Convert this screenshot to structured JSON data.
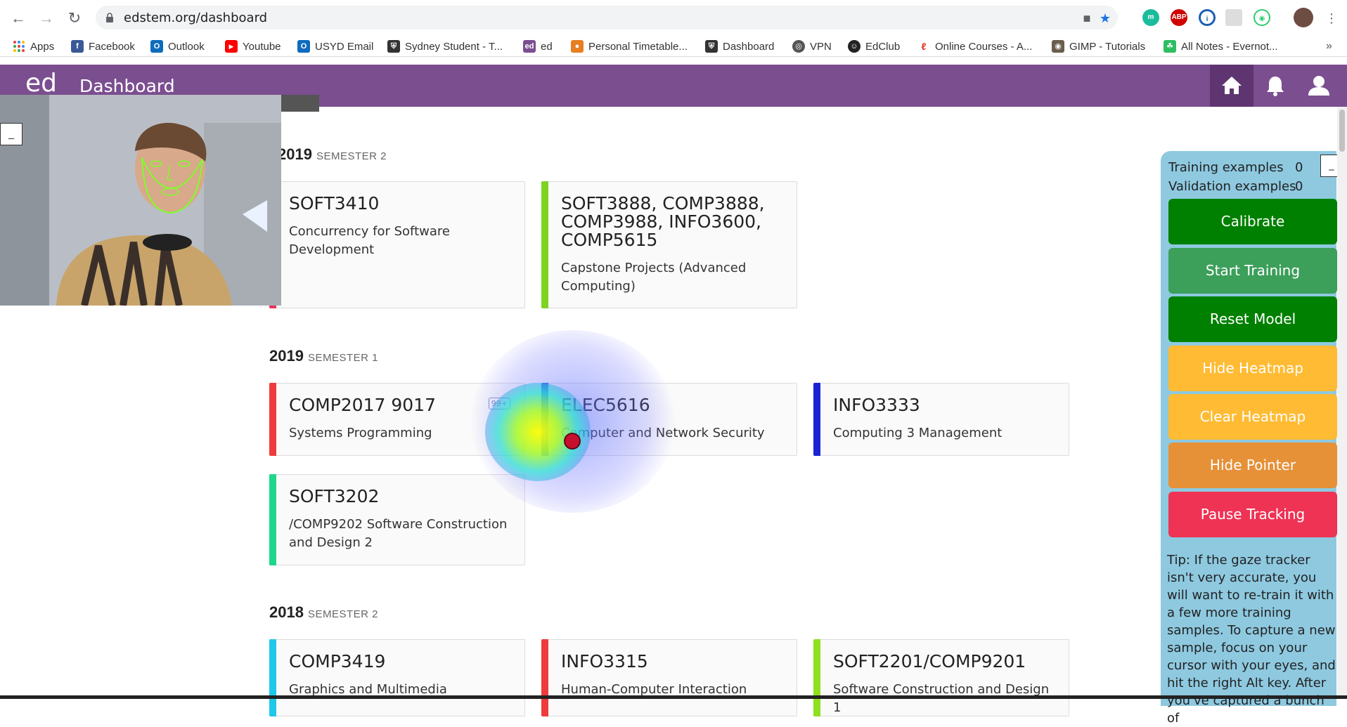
{
  "browser": {
    "url": "edstem.org/dashboard",
    "bookmarks": [
      {
        "label": "Apps",
        "icon": "apps-grid-icon",
        "color": "#e8453c"
      },
      {
        "label": "Facebook",
        "icon": "facebook-icon",
        "color": "#3b5998"
      },
      {
        "label": "Outlook",
        "icon": "outlook-icon",
        "color": "#0f6cbd"
      },
      {
        "label": "Youtube",
        "icon": "youtube-icon",
        "color": "#ff0000"
      },
      {
        "label": "USYD Email",
        "icon": "outlook-icon",
        "color": "#0f6cbd"
      },
      {
        "label": "Sydney Student - T...",
        "icon": "usyd-shield-icon",
        "color": "#333333"
      },
      {
        "label": "ed",
        "icon": "ed-icon",
        "color": "#7b4e90"
      },
      {
        "label": "Personal Timetable...",
        "icon": "timetable-icon",
        "color": "#e67e22"
      },
      {
        "label": "Dashboard",
        "icon": "usyd-shield-icon",
        "color": "#333333"
      },
      {
        "label": "VPN",
        "icon": "globe-icon",
        "color": "#555555"
      },
      {
        "label": "EdClub",
        "icon": "edclub-icon",
        "color": "#222222"
      },
      {
        "label": "Online Courses - A...",
        "icon": "adobe-icon",
        "color": "#e0301e"
      },
      {
        "label": "GIMP - Tutorials",
        "icon": "gimp-icon",
        "color": "#6b5e4f"
      },
      {
        "label": "All Notes - Evernot...",
        "icon": "evernote-icon",
        "color": "#2dbe60"
      }
    ]
  },
  "header": {
    "logo": "ed",
    "title": "Dashboard"
  },
  "semesters": [
    {
      "year": "2019",
      "sem": "SEMESTER 2",
      "courses": [
        {
          "code": "SOFT3410",
          "name": "Concurrency for Software Development",
          "color": "#e8325a"
        },
        {
          "code": "SOFT3888, COMP3888, COMP3988, INFO3600, COMP5615",
          "name": "Capstone Projects (Advanced Computing)",
          "color": "#7ed321"
        }
      ]
    },
    {
      "year": "2019",
      "sem": "SEMESTER 1",
      "courses": [
        {
          "code": "COMP2017 9017",
          "name": "Systems Programming",
          "color": "#ef3b3b",
          "badge": "99+"
        },
        {
          "code": "ELEC5616",
          "name": "Computer and Network Security",
          "color": "#2b5ce6"
        },
        {
          "code": "INFO3333",
          "name": "Computing 3 Management",
          "color": "#1a24d6"
        },
        {
          "code": "SOFT3202",
          "name": "/COMP9202 Software Construction and Design 2",
          "color": "#1fd68a"
        }
      ]
    },
    {
      "year": "2018",
      "sem": "SEMESTER 2",
      "courses": [
        {
          "code": "COMP3419",
          "name": "Graphics and Multimedia",
          "color": "#1ec8e8"
        },
        {
          "code": "INFO3315",
          "name": "Human-Computer Interaction",
          "color": "#ef3b3b"
        },
        {
          "code": "SOFT2201/COMP9201",
          "name": "Software Construction and Design 1",
          "color": "#8fe01e"
        }
      ]
    }
  ],
  "panel": {
    "training_label": "Training examples",
    "training_count": "0",
    "validation_label": "Validation examples",
    "validation_count": "0",
    "minimize": "_",
    "buttons": [
      {
        "label": "Calibrate",
        "color": "#008000"
      },
      {
        "label": "Start Training",
        "color": "#3c9f5a"
      },
      {
        "label": "Reset Model",
        "color": "#008000"
      },
      {
        "label": "Hide Heatmap",
        "color": "#ffbb33"
      },
      {
        "label": "Clear Heatmap",
        "color": "#ffbb33"
      },
      {
        "label": "Hide Pointer",
        "color": "#e69138"
      },
      {
        "label": "Pause Tracking",
        "color": "#ee3355"
      }
    ],
    "tip": "Tip: If the gaze tracker isn't very accurate, you will want to re-train it with a few more training samples. To capture a new sample, focus on your cursor with your eyes, and hit the right Alt key. After you've captured a bunch of"
  },
  "webcam": {
    "minimize": "_"
  }
}
